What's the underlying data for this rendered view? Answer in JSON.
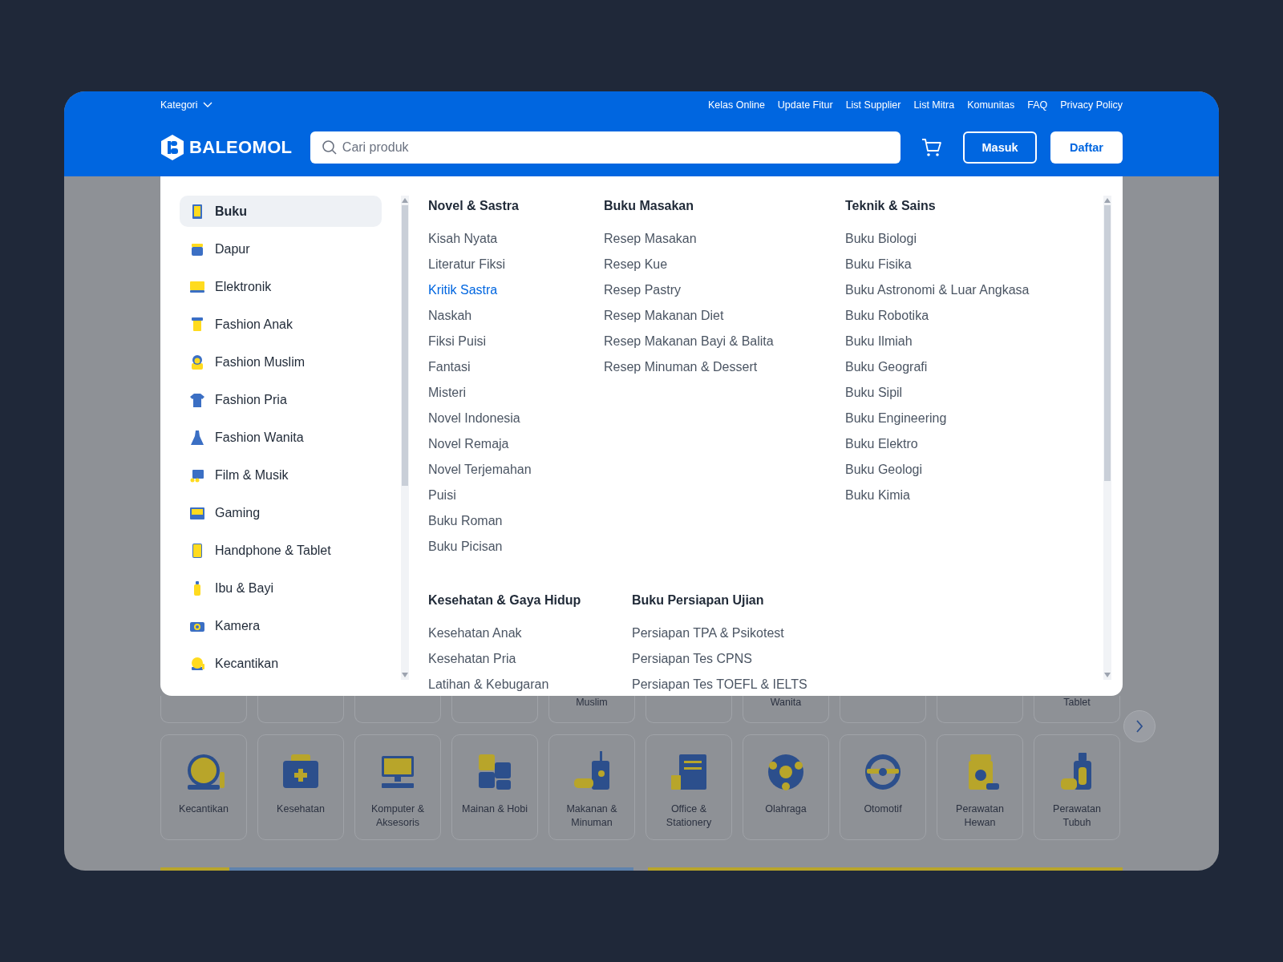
{
  "top_bar": {
    "category_menu": "Kategori",
    "links": [
      "Kelas Online",
      "Update Fitur",
      "List Supplier",
      "List Mitra",
      "Komunitas",
      "FAQ",
      "Privacy Policy"
    ]
  },
  "header": {
    "logo": "BALEOMOL",
    "search": {
      "placeholder": "Cari produk"
    },
    "buttons": [
      {
        "label": "Masuk",
        "kind": "outline"
      },
      {
        "label": "Daftar",
        "kind": "solid"
      }
    ]
  },
  "dropdown": {
    "sidebar": {
      "items": [
        {
          "label": "Buku",
          "selected": true
        },
        {
          "label": "Dapur",
          "selected": false
        },
        {
          "label": "Elektronik",
          "selected": false
        },
        {
          "label": "Fashion Anak",
          "selected": false
        },
        {
          "label": "Fashion Muslim",
          "selected": false
        },
        {
          "label": "Fashion Pria",
          "selected": false
        },
        {
          "label": "Fashion Wanita",
          "selected": false
        },
        {
          "label": "Film & Musik",
          "selected": false
        },
        {
          "label": "Gaming",
          "selected": false
        },
        {
          "label": "Handphone & Tablet",
          "selected": false
        },
        {
          "label": "Ibu & Bayi",
          "selected": false
        },
        {
          "label": "Kamera",
          "selected": false
        },
        {
          "label": "Kecantikan",
          "selected": false
        }
      ]
    },
    "sections": [
      {
        "columns": [
          {
            "title": "Novel & Sastra",
            "items": [
              {
                "label": "Kisah Nyata",
                "selected": false
              },
              {
                "label": "Literatur Fiksi",
                "selected": false
              },
              {
                "label": "Kritik Sastra",
                "selected": true
              },
              {
                "label": "Naskah",
                "selected": false
              },
              {
                "label": "Fiksi Puisi",
                "selected": false
              },
              {
                "label": "Fantasi",
                "selected": false
              },
              {
                "label": "Misteri",
                "selected": false
              },
              {
                "label": "Novel Indonesia",
                "selected": false
              },
              {
                "label": "Novel Remaja",
                "selected": false
              },
              {
                "label": "Novel Terjemahan",
                "selected": false
              },
              {
                "label": "Puisi",
                "selected": false
              },
              {
                "label": "Buku Roman",
                "selected": false
              },
              {
                "label": "Buku Picisan",
                "selected": false
              }
            ]
          },
          {
            "title": "Buku Masakan",
            "items": [
              {
                "label": "Resep Masakan",
                "selected": false
              },
              {
                "label": "Resep Kue",
                "selected": false
              },
              {
                "label": "Resep Pastry",
                "selected": false
              },
              {
                "label": "Resep Makanan Diet",
                "selected": false
              },
              {
                "label": "Resep Makanan Bayi & Balita",
                "selected": false
              },
              {
                "label": "Resep Minuman & Dessert",
                "selected": false
              }
            ]
          },
          {
            "title": "Teknik & Sains",
            "items": [
              {
                "label": "Buku Biologi",
                "selected": false
              },
              {
                "label": "Buku Fisika",
                "selected": false
              },
              {
                "label": "Buku Astronomi & Luar Angkasa",
                "selected": false
              },
              {
                "label": "Buku Robotika",
                "selected": false
              },
              {
                "label": "Buku Ilmiah",
                "selected": false
              },
              {
                "label": "Buku Geografi",
                "selected": false
              },
              {
                "label": "Buku Sipil",
                "selected": false
              },
              {
                "label": "Buku Engineering",
                "selected": false
              },
              {
                "label": "Buku Elektro",
                "selected": false
              },
              {
                "label": "Buku Geologi",
                "selected": false
              },
              {
                "label": "Buku Kimia",
                "selected": false
              }
            ]
          }
        ]
      },
      {
        "columns": [
          {
            "title": "Kesehatan & Gaya Hidup",
            "items": [
              {
                "label": "Kesehatan Anak",
                "selected": false
              },
              {
                "label": "Kesehatan Pria",
                "selected": false
              },
              {
                "label": "Latihan & Kebugaran",
                "selected": false
              }
            ]
          },
          {
            "title": "Buku Persiapan Ujian",
            "items": [
              {
                "label": "Persiapan TPA & Psikotest",
                "selected": false
              },
              {
                "label": "Persiapan Tes CPNS",
                "selected": false
              },
              {
                "label": "Persiapan Tes TOEFL & IELTS",
                "selected": false
              }
            ]
          }
        ]
      }
    ]
  },
  "category_cards": {
    "partial_row": [
      {
        "kind": "blank"
      },
      {
        "kind": "blank"
      },
      {
        "kind": "blank"
      },
      {
        "kind": "blank"
      },
      {
        "kind": "labelled",
        "label": "Muslim"
      },
      {
        "kind": "blank"
      },
      {
        "kind": "labelled",
        "label": "Wanita"
      },
      {
        "kind": "blank"
      },
      {
        "kind": "blank"
      },
      {
        "kind": "labelled",
        "label": "Tablet"
      }
    ],
    "row": [
      "Kecantikan",
      "Kesehatan",
      "Komputer & Aksesoris",
      "Mainan & Hobi",
      "Makanan & Minuman",
      "Office & Stationery",
      "Olahraga",
      "Otomotif",
      "Perawatan Hewan",
      "Perawatan Tubuh"
    ]
  }
}
